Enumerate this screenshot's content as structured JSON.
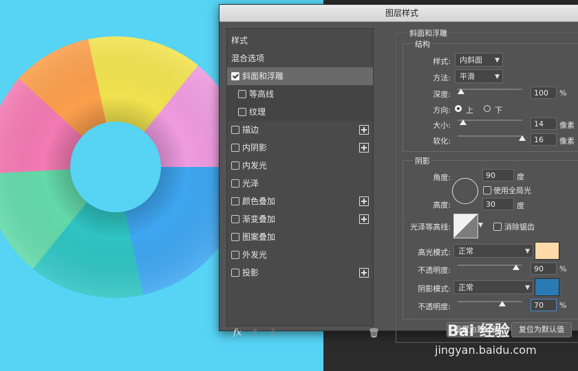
{
  "dialog": {
    "title": "图层样式"
  },
  "style_list": {
    "items": [
      {
        "label": "样式",
        "checkbox": false
      },
      {
        "label": "混合选项",
        "checkbox": false
      },
      {
        "label": "斜面和浮雕",
        "checkbox": true,
        "checked": true,
        "selected": true
      },
      {
        "label": "等高线",
        "checkbox": true,
        "checked": false,
        "sub": true
      },
      {
        "label": "纹理",
        "checkbox": true,
        "checked": false,
        "sub": true
      },
      {
        "label": "描边",
        "checkbox": true,
        "checked": false,
        "add": true
      },
      {
        "label": "内阴影",
        "checkbox": true,
        "checked": false,
        "add": true
      },
      {
        "label": "内发光",
        "checkbox": true,
        "checked": false
      },
      {
        "label": "光泽",
        "checkbox": true,
        "checked": false
      },
      {
        "label": "颜色叠加",
        "checkbox": true,
        "checked": false,
        "add": true
      },
      {
        "label": "渐变叠加",
        "checkbox": true,
        "checked": false,
        "add": true
      },
      {
        "label": "图案叠加",
        "checkbox": true,
        "checked": false
      },
      {
        "label": "外发光",
        "checkbox": true,
        "checked": false
      },
      {
        "label": "投影",
        "checkbox": true,
        "checked": false,
        "add": true
      }
    ],
    "fx_label": "fx"
  },
  "bevel": {
    "section_title": "斜面和浮雕",
    "structure": {
      "title": "结构",
      "style_label": "样式:",
      "style_value": "内斜面",
      "technique_label": "方法:",
      "technique_value": "平滑",
      "depth_label": "深度:",
      "depth_value": "100",
      "depth_unit": "%",
      "direction_label": "方向:",
      "direction_up": "上",
      "direction_down": "下",
      "size_label": "大小:",
      "size_value": "14",
      "size_unit": "像素",
      "soften_label": "软化:",
      "soften_value": "16",
      "soften_unit": "像素"
    },
    "shading": {
      "title": "阴影",
      "angle_label": "角度:",
      "angle_value": "90",
      "angle_unit": "度",
      "global_light_label": "使用全局光",
      "altitude_label": "高度:",
      "altitude_value": "30",
      "altitude_unit": "度",
      "gloss_contour_label": "光泽等高线:",
      "antialias_label": "消除锯齿",
      "highlight_mode_label": "高光模式:",
      "highlight_mode_value": "正常",
      "highlight_color": "#ffd9a8",
      "highlight_opacity_label": "不透明度:",
      "highlight_opacity_value": "90",
      "highlight_opacity_unit": "%",
      "shadow_mode_label": "阴影模式:",
      "shadow_mode_value": "正常",
      "shadow_color": "#2a7ab3",
      "shadow_opacity_label": "不透明度:",
      "shadow_opacity_value": "70",
      "shadow_opacity_unit": "%"
    },
    "buttons": {
      "make_default": "设置为默认值",
      "reset_default": "复位为默认值"
    }
  },
  "watermark": {
    "brand": "Bai 经验",
    "url": "jingyan.baidu.com"
  }
}
